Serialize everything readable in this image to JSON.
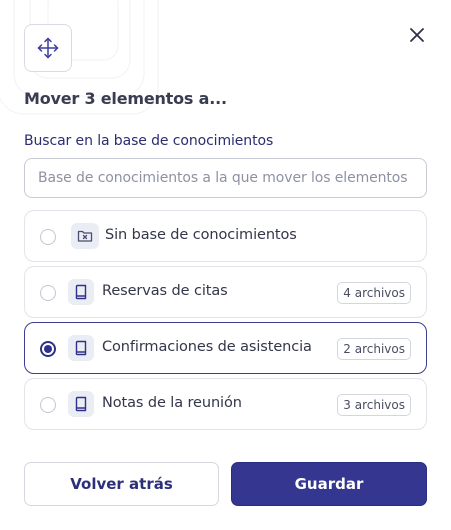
{
  "dialog": {
    "title": "Mover 3 elementos a...",
    "search_label": "Buscar en la base de conocimientos",
    "search_placeholder": "Base de conocimientos a la que mover los elementos",
    "search_value": ""
  },
  "options": [
    {
      "label": "Sin base de conocimientos",
      "badge": "",
      "icon": "folder-x-icon",
      "selected": false
    },
    {
      "label": "Reservas de citas",
      "badge": "4 archivos",
      "icon": "book-icon",
      "selected": false
    },
    {
      "label": "Confirmaciones de asistencia",
      "badge": "2 archivos",
      "icon": "book-icon",
      "selected": true
    },
    {
      "label": "Notas de la reunión",
      "badge": "3 archivos",
      "icon": "book-icon",
      "selected": false
    }
  ],
  "footer": {
    "back_label": "Volver atrás",
    "save_label": "Guardar"
  },
  "colors": {
    "primary": "#34368f",
    "selected_border": "#3d3f8f"
  }
}
